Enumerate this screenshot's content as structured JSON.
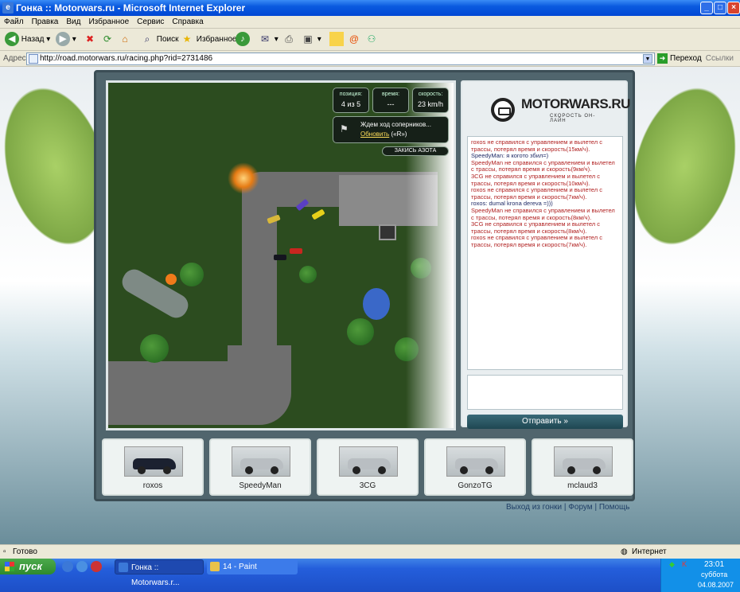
{
  "window": {
    "title": "Гонка :: Motorwars.ru - Microsoft Internet Explorer"
  },
  "menu": [
    "Файл",
    "Правка",
    "Вид",
    "Избранное",
    "Сервис",
    "Справка"
  ],
  "toolbar": {
    "back": "Назад",
    "search": "Поиск",
    "favorites": "Избранное"
  },
  "address": {
    "label": "Адрес:",
    "url": "http://road.motorwars.ru/racing.php?rid=2731486",
    "go": "Переход",
    "links": "Ссылки"
  },
  "hud": {
    "position_label": "позиция:",
    "position_value": "4 из 5",
    "time_label": "время:",
    "time_value": "---",
    "speed_label": "скорость:",
    "speed_value": "23 km/h",
    "waiting": "Ждем ход соперников...",
    "refresh": "Обновить",
    "hotkey": "(«R»)",
    "nitro": "ЗАКИСЬ АЗОТА"
  },
  "logo": {
    "name": "MOTORWARS.RU",
    "tagline": "СКОРОСТЬ ОН-ЛАЙН"
  },
  "chat": [
    {
      "text": "roxos не справился с управлением и вылетел с трассы, потерял время и скорость(15км/ч).",
      "type": "system"
    },
    {
      "text": "SpeedyMan: я когото збил=)",
      "type": "user"
    },
    {
      "text": "SpeedyMan не справился с управлением и вылетел с трассы, потерял время и скорость(9км/ч).",
      "type": "system"
    },
    {
      "text": "3CG не справился с управлением и вылетел с трассы, потерял время и скорость(10км/ч).",
      "type": "system"
    },
    {
      "text": "roxos не справился с управлением и вылетел с трассы, потерял время и скорость(7км/ч).",
      "type": "system"
    },
    {
      "text": "roxos: dumal krona dereva =)))",
      "type": "user"
    },
    {
      "text": "SpeedyMan не справился с управлением и вылетел с трассы, потерял время и скорость(8км/ч).",
      "type": "system"
    },
    {
      "text": "3CG не справился с управлением и вылетел с трассы, потерял время и скорость(8км/ч).",
      "type": "system"
    },
    {
      "text": "roxos не справился с управлением и вылетел с трассы, потерял время и скорость(7км/ч).",
      "type": "system"
    }
  ],
  "send_button": "Отправить »",
  "players": [
    {
      "name": "roxos",
      "car_color": "#1b2130"
    },
    {
      "name": "SpeedyMan",
      "car_color": "#b9bec2"
    },
    {
      "name": "3CG",
      "car_color": "#b9bec2"
    },
    {
      "name": "GonzoTG",
      "car_color": "#b9bec2"
    },
    {
      "name": "mclaud3",
      "car_color": "#b9bec2"
    }
  ],
  "footer_links": {
    "leave": "Выход из гонки",
    "forum": "Форум",
    "help": "Помощь",
    "sep": "|"
  },
  "status": {
    "left": "Готово",
    "zone": "Интернет"
  },
  "taskbar": {
    "start": "пуск",
    "tasks": [
      "Гонка :: Motorwars.r...",
      "14 - Paint"
    ],
    "time": "23:01",
    "day": "суббота",
    "date": "04.08.2007"
  }
}
